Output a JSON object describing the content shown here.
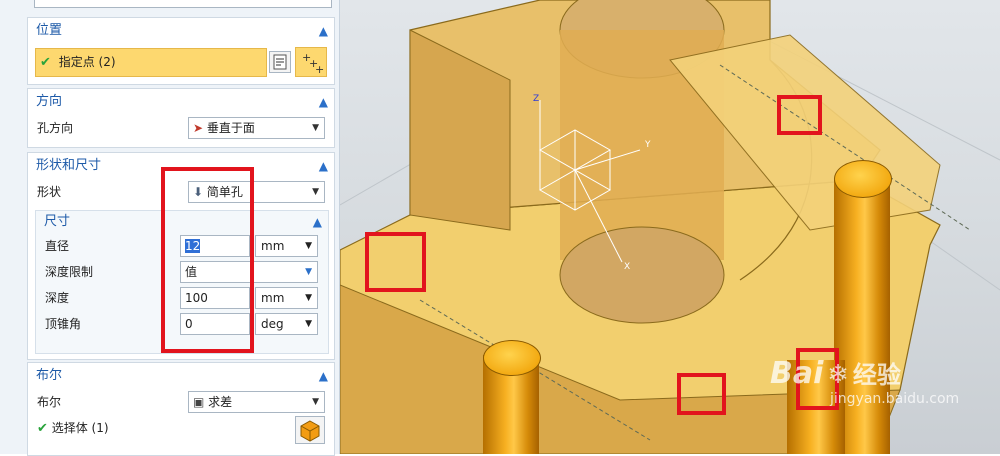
{
  "position": {
    "title": "位置",
    "specify_point": "指定点 (2)"
  },
  "direction": {
    "title": "方向",
    "hole_dir_label": "孔方向",
    "hole_dir_value": "垂直于面"
  },
  "shape": {
    "title": "形状和尺寸",
    "shape_label": "形状",
    "shape_value": "简单孔"
  },
  "dims": {
    "title": "尺寸",
    "diameter_label": "直径",
    "diameter_value": "12",
    "diameter_unit": "mm",
    "depth_limit_label": "深度限制",
    "depth_limit_value": "值",
    "depth_label": "深度",
    "depth_value": "100",
    "depth_unit": "mm",
    "tip_angle_label": "顶锥角",
    "tip_angle_value": "0",
    "tip_angle_unit": "deg"
  },
  "boolean": {
    "title": "布尔",
    "label": "布尔",
    "value": "求差",
    "select_body": "选择体 (1)"
  },
  "viewport": {
    "axis_z": "Z",
    "axis_y": "Y",
    "axis_x": "X"
  },
  "watermark": {
    "brand": "Bai",
    "brand2": "经验",
    "url": "jingyan.baidu.com"
  },
  "icons": {
    "check": "✔",
    "chevron": "^"
  }
}
